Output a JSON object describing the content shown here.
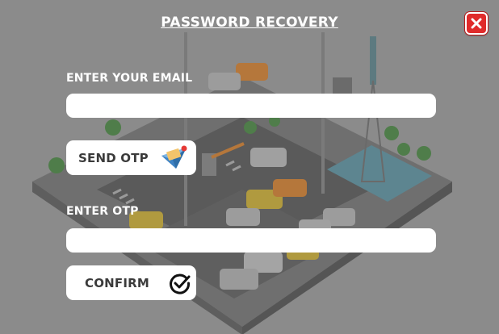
{
  "dialog": {
    "title": "PASSWORD RECOVERY",
    "email_label": "ENTER YOUR EMAIL",
    "email_value": "",
    "send_otp_label": "SEND OTP",
    "otp_label": "ENTER OTP",
    "otp_value": "",
    "confirm_label": "CONFIRM"
  },
  "icons": {
    "close": "close-icon",
    "send": "paper-plane-icon",
    "confirm": "check-circle-icon"
  },
  "colors": {
    "overlay": "#8b8b8b",
    "close_button": "#e02b2b",
    "field_background": "#ffffff",
    "text": "#ffffff"
  }
}
